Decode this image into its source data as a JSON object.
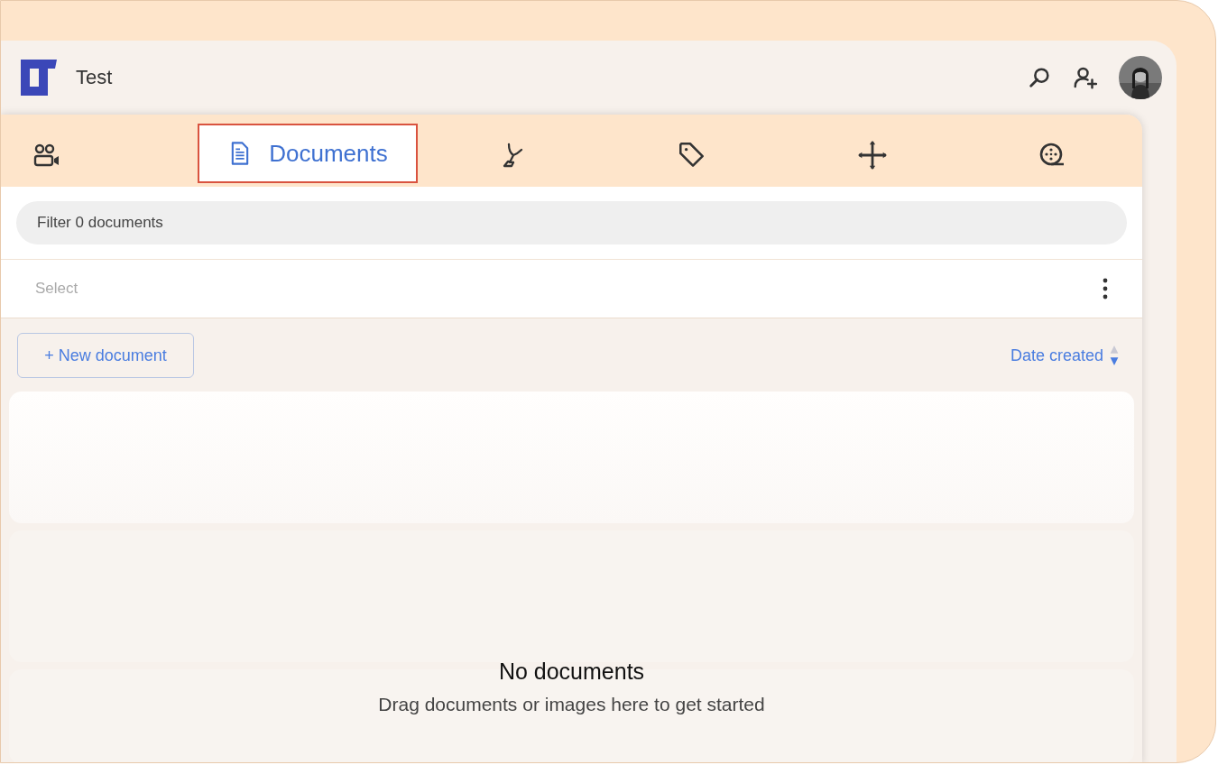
{
  "header": {
    "title": "Test",
    "actions": [
      {
        "kind": "search"
      },
      {
        "kind": "add-user"
      },
      {
        "kind": "avatar"
      }
    ]
  },
  "tabs": [
    {
      "kind": "people",
      "selected": false
    },
    {
      "kind": "document",
      "label": "Documents",
      "selected": true
    },
    {
      "kind": "brush",
      "selected": false
    },
    {
      "kind": "tag",
      "selected": false
    },
    {
      "kind": "move",
      "selected": false
    },
    {
      "kind": "film",
      "selected": false
    }
  ],
  "filter": {
    "placeholder": "Filter 0 documents"
  },
  "select_bar": {
    "label": "Select"
  },
  "toolbar": {
    "new_button": "+ New document",
    "sort": "Date created"
  },
  "empty_state": {
    "title": "No documents",
    "message": "Drag documents or images here to get started"
  }
}
